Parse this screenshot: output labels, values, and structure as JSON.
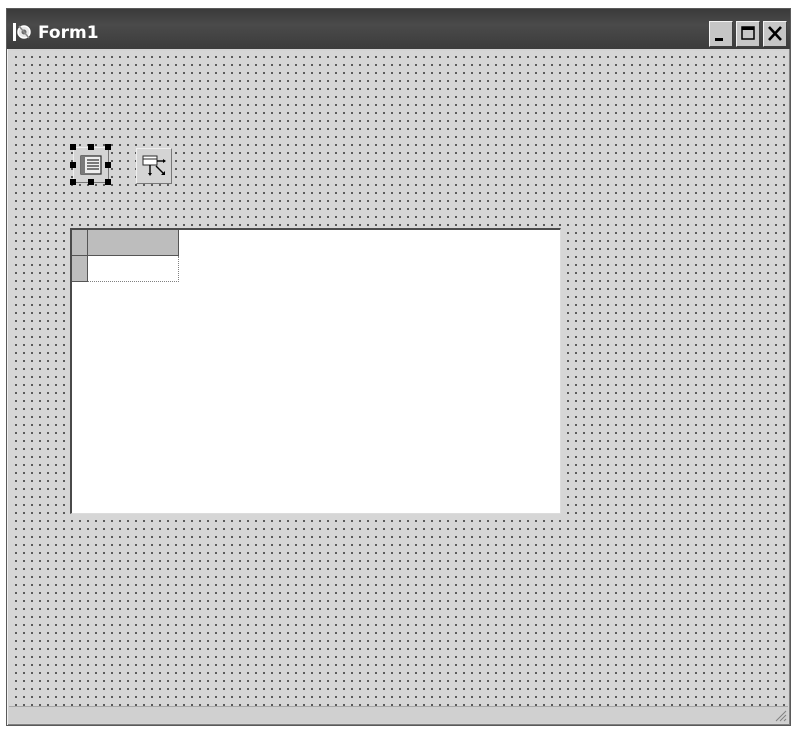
{
  "window": {
    "title": "Form1",
    "app_icon": "delphi-form-icon",
    "buttons": [
      "minimize-icon",
      "maximize-icon",
      "close-icon"
    ]
  },
  "form": {
    "components": [
      {
        "name": "data-source-component",
        "icon": "data-source-icon",
        "selected": true
      },
      {
        "name": "data-connection-component",
        "icon": "connection-arrows-icon",
        "selected": false
      }
    ],
    "grid": {
      "columns": 1,
      "rows": 1,
      "cells": [
        [
          ""
        ]
      ]
    }
  },
  "colors": {
    "titlebar": "#3c3c3c",
    "form_background": "#d6d6d6",
    "grid_background": "#ffffff"
  }
}
